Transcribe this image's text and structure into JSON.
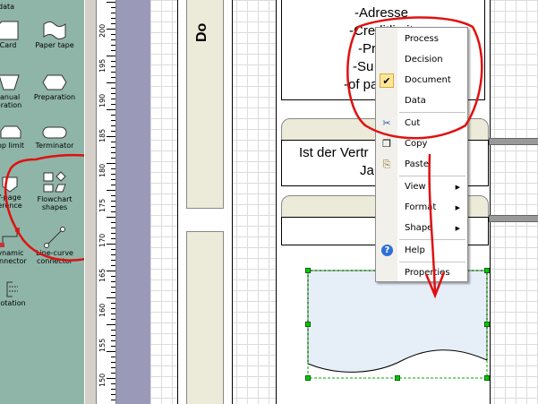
{
  "stencil": {
    "items": [
      {
        "label": "data"
      },
      {
        "label": "Card"
      },
      {
        "label": "Paper tape"
      },
      {
        "label": "Manual operation",
        "line1": "lanual",
        "line2": "eration"
      },
      {
        "label": "Preparation"
      },
      {
        "label": "Loop limit",
        "line1": "op limit"
      },
      {
        "label": "Terminator"
      },
      {
        "label": "Off-page reference",
        "line1": "f-page",
        "line2": "erence"
      },
      {
        "label": "Flowchart shapes",
        "line1": "Flowchart",
        "line2": "shapes"
      },
      {
        "label": "Dynamic connector",
        "line1": "ynamic",
        "line2": "onnector"
      },
      {
        "label": "Line-curve connector",
        "line1": "Line-curve",
        "line2": "connector"
      },
      {
        "label": "Annotation",
        "line1": "notation"
      }
    ]
  },
  "ruler": {
    "labels": [
      "200",
      "195",
      "190",
      "185",
      "180",
      "175",
      "170",
      "165",
      "160",
      "155",
      "150"
    ]
  },
  "canvas": {
    "header_text": "Do",
    "list_lines": [
      "-Adresse",
      "-Creditlimit",
      "-Pr",
      "-Su",
      "-of pa"
    ],
    "box_text_line1": "Ist der Vertr",
    "box_text_line2": "Ja"
  },
  "context_menu": {
    "items": [
      {
        "label": "Process",
        "icon": "none",
        "submenu": false
      },
      {
        "label": "Decision",
        "icon": "none",
        "submenu": false
      },
      {
        "label": "Document",
        "icon": "checkmark-icon",
        "submenu": false,
        "checked": true
      },
      {
        "label": "Data",
        "icon": "none",
        "submenu": false
      },
      {
        "label": "Cut",
        "icon": "scissors-icon",
        "submenu": false
      },
      {
        "label": "Copy",
        "icon": "copy-icon",
        "submenu": false
      },
      {
        "label": "Paste",
        "icon": "paste-icon",
        "submenu": false
      },
      {
        "label": "View",
        "icon": "none",
        "submenu": true
      },
      {
        "label": "Format",
        "icon": "none",
        "submenu": true
      },
      {
        "label": "Shape",
        "icon": "none",
        "submenu": true
      },
      {
        "label": "Help",
        "icon": "help-icon",
        "submenu": false
      },
      {
        "label": "Properties",
        "icon": "none",
        "submenu": false
      }
    ]
  },
  "colors": {
    "stencil_bg": "#8fb5a8",
    "annotation_red": "#e01010",
    "selection_green": "#00cc00",
    "document_fill": "#e6eef8"
  }
}
